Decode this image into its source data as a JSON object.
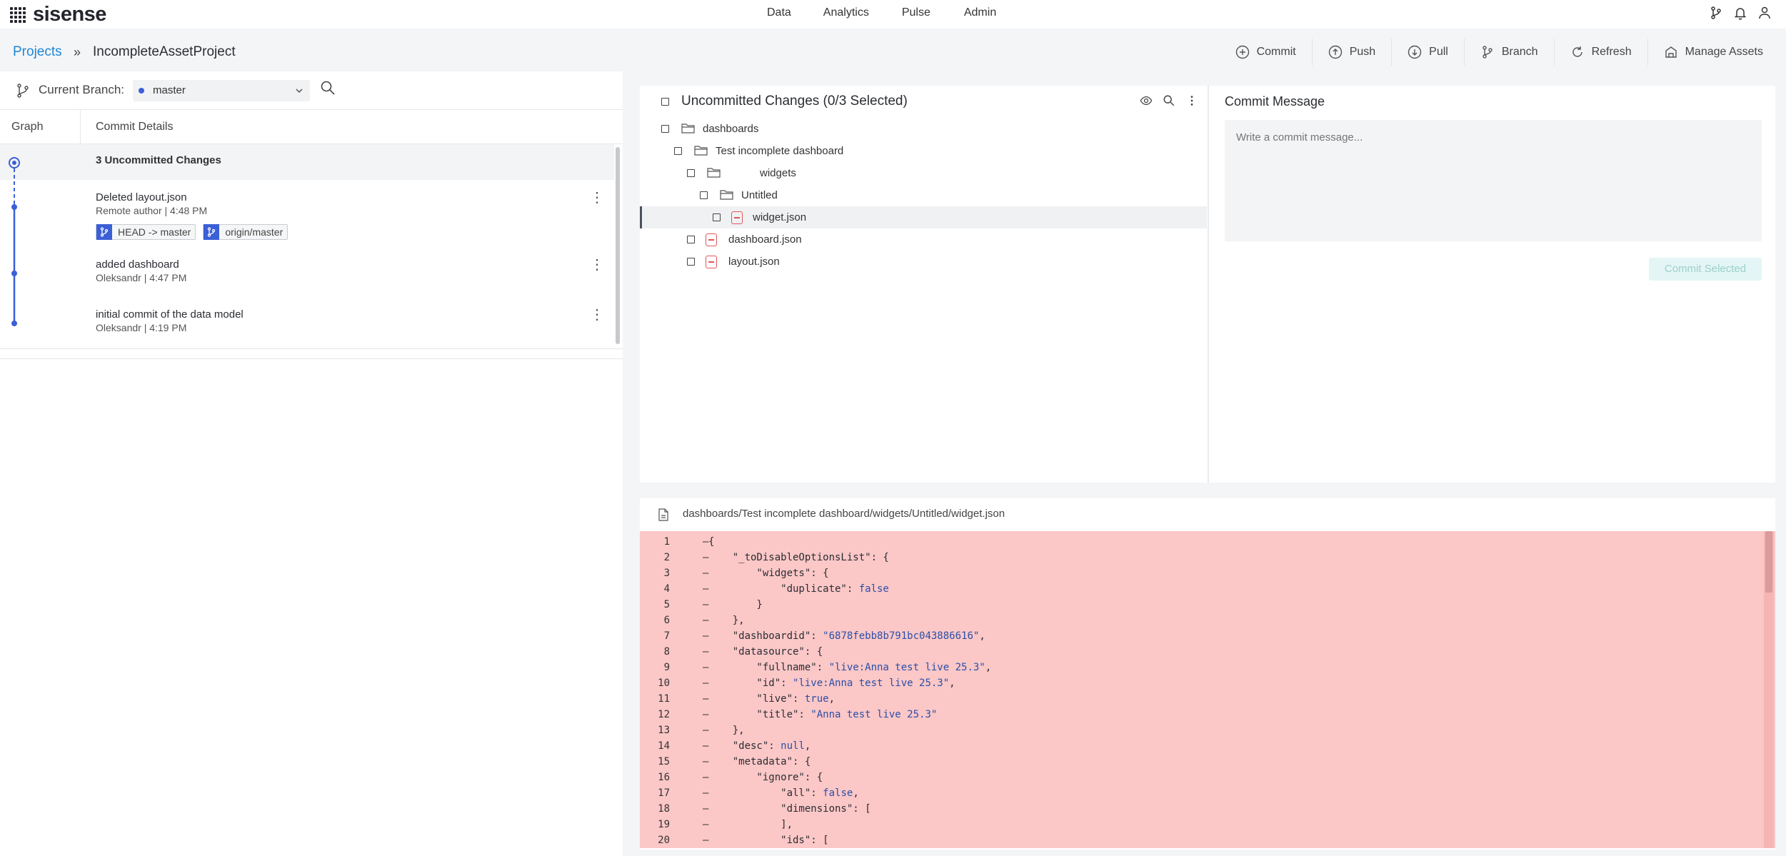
{
  "app": {
    "logo_text": "sisense"
  },
  "nav": {
    "items": [
      "Data",
      "Analytics",
      "Pulse",
      "Admin"
    ]
  },
  "breadcrumb": {
    "root": "Projects",
    "separator": "»",
    "current": "IncompleteAssetProject"
  },
  "actions": {
    "commit": "Commit",
    "push": "Push",
    "pull": "Pull",
    "branch": "Branch",
    "refresh": "Refresh",
    "manage_assets": "Manage Assets"
  },
  "branch_bar": {
    "label": "Current Branch:",
    "value": "master",
    "dot_color": "#3b5fd6"
  },
  "columns": {
    "graph": "Graph",
    "details": "Commit Details"
  },
  "commits": {
    "uncommitted": "3 Uncommitted Changes",
    "items": [
      {
        "title": "Deleted layout.json",
        "meta": "Remote author | 4:48 PM",
        "tags": [
          "HEAD -> master",
          "origin/master"
        ]
      },
      {
        "title": "added dashboard",
        "meta": "Oleksandr | 4:47 PM"
      },
      {
        "title": "initial commit of the data model",
        "meta": "Oleksandr | 4:19 PM"
      }
    ]
  },
  "changes": {
    "title": "Uncommitted Changes (0/3 Selected)",
    "tree": [
      {
        "label": "dashboards",
        "type": "folder"
      },
      {
        "label": "Test incomplete dashboard",
        "type": "folder"
      },
      {
        "label": "widgets",
        "type": "folder"
      },
      {
        "label": "Untitled",
        "type": "folder"
      },
      {
        "label": "widget.json",
        "type": "deleted-file"
      },
      {
        "label": "dashboard.json",
        "type": "deleted-file"
      },
      {
        "label": "layout.json",
        "type": "deleted-file"
      }
    ]
  },
  "commit_panel": {
    "title": "Commit Message",
    "placeholder": "Write a commit message...",
    "button": "Commit Selected"
  },
  "diff": {
    "path": "dashboards/Test incomplete dashboard/widgets/Untitled/widget.json",
    "lines": [
      {
        "n": "1",
        "m": "—",
        "t": "{"
      },
      {
        "n": "2",
        "m": "—",
        "t": "    \"_toDisableOptionsList\": {"
      },
      {
        "n": "3",
        "m": "—",
        "t": "        \"widgets\": {"
      },
      {
        "n": "4",
        "m": "—",
        "t": "            \"duplicate\": false"
      },
      {
        "n": "5",
        "m": "—",
        "t": "        }"
      },
      {
        "n": "6",
        "m": "—",
        "t": "    },"
      },
      {
        "n": "7",
        "m": "—",
        "t": "    \"dashboardid\": \"6878febb8b791bc043886616\","
      },
      {
        "n": "8",
        "m": "—",
        "t": "    \"datasource\": {"
      },
      {
        "n": "9",
        "m": "—",
        "t": "        \"fullname\": \"live:Anna test live 25.3\","
      },
      {
        "n": "10",
        "m": "—",
        "t": "        \"id\": \"live:Anna test live 25.3\","
      },
      {
        "n": "11",
        "m": "—",
        "t": "        \"live\": true,"
      },
      {
        "n": "12",
        "m": "—",
        "t": "        \"title\": \"Anna test live 25.3\""
      },
      {
        "n": "13",
        "m": "—",
        "t": "    },"
      },
      {
        "n": "14",
        "m": "—",
        "t": "    \"desc\": null,"
      },
      {
        "n": "15",
        "m": "—",
        "t": "    \"metadata\": {"
      },
      {
        "n": "16",
        "m": "—",
        "t": "        \"ignore\": {"
      },
      {
        "n": "17",
        "m": "—",
        "t": "            \"all\": false,"
      },
      {
        "n": "18",
        "m": "—",
        "t": "            \"dimensions\": ["
      },
      {
        "n": "19",
        "m": "—",
        "t": "            ],"
      },
      {
        "n": "20",
        "m": "—",
        "t": "            \"ids\": ["
      }
    ]
  },
  "colors": {
    "accent_blue": "#1f86d6",
    "graph_blue": "#3b5fd6",
    "diff_deleted_bg": "#fbc7c7",
    "delete_red": "#e0565a",
    "button_teal_disabled": "#e3f6f5"
  }
}
